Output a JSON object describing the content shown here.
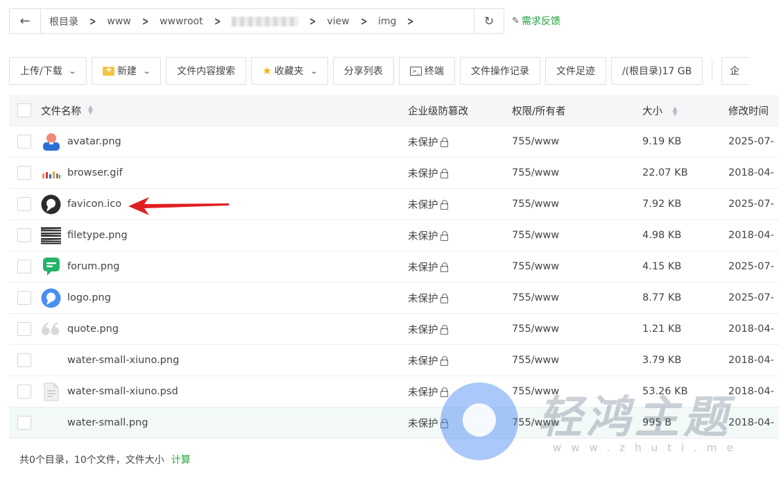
{
  "breadcrumb": {
    "back_icon": "arrow-left-icon",
    "items": [
      "根目录",
      "www",
      "wwwroot",
      "",
      "view",
      "img"
    ],
    "refresh_icon": "refresh-icon"
  },
  "feedback": {
    "label": "需求反馈",
    "icon": "edit-icon"
  },
  "toolbar": {
    "upload_download": "上传/下载",
    "new": "新建",
    "content_search": "文件内容搜索",
    "favorites": "收藏夹",
    "share_list": "分享列表",
    "terminal": "终端",
    "op_log": "文件操作记录",
    "footprint": "文件足迹",
    "disk": "/(根目录)17 GB",
    "cut_label": "企"
  },
  "table": {
    "headers": {
      "name": "文件名称",
      "protect": "企业级防篡改",
      "perm": "权限/所有者",
      "size": "大小",
      "time": "修改时间"
    },
    "rows": [
      {
        "name": "avatar.png",
        "icon": "avatar-image-icon",
        "protect": "未保护",
        "perm": "755/www",
        "size": "9.19 KB",
        "time": "2025-07-"
      },
      {
        "name": "browser.gif",
        "icon": "browser-image-icon",
        "protect": "未保护",
        "perm": "755/www",
        "size": "22.07 KB",
        "time": "2018-04-"
      },
      {
        "name": "favicon.ico",
        "icon": "favicon-image-icon",
        "protect": "未保护",
        "perm": "755/www",
        "size": "7.92 KB",
        "time": "2025-07-"
      },
      {
        "name": "filetype.png",
        "icon": "filetype-image-icon",
        "protect": "未保护",
        "perm": "755/www",
        "size": "4.98 KB",
        "time": "2018-04-"
      },
      {
        "name": "forum.png",
        "icon": "forum-image-icon",
        "protect": "未保护",
        "perm": "755/www",
        "size": "4.15 KB",
        "time": "2025-07-"
      },
      {
        "name": "logo.png",
        "icon": "logo-image-icon",
        "protect": "未保护",
        "perm": "755/www",
        "size": "8.77 KB",
        "time": "2025-07-"
      },
      {
        "name": "quote.png",
        "icon": "quote-image-icon",
        "protect": "未保护",
        "perm": "755/www",
        "size": "1.21 KB",
        "time": "2018-04-"
      },
      {
        "name": "water-small-xiuno.png",
        "icon": "blank-image-icon",
        "protect": "未保护",
        "perm": "755/www",
        "size": "3.79 KB",
        "time": "2018-04-"
      },
      {
        "name": "water-small-xiuno.psd",
        "icon": "document-file-icon",
        "protect": "未保护",
        "perm": "755/www",
        "size": "53.26 KB",
        "time": "2018-04-"
      },
      {
        "name": "water-small.png",
        "icon": "blank-image-icon",
        "protect": "未保护",
        "perm": "755/www",
        "size": "995 B",
        "time": "2018-04-"
      }
    ]
  },
  "footer": {
    "summary": "共0个目录，10个文件，文件大小",
    "calc": "计算"
  },
  "watermark": {
    "title": "轻鸿主题",
    "url": "www.zhuti.me"
  },
  "colors": {
    "accent": "#20a53a",
    "arrow": "#e02020",
    "header_bg": "#f5f6f7",
    "highlight_row": "#f2f9f6"
  }
}
